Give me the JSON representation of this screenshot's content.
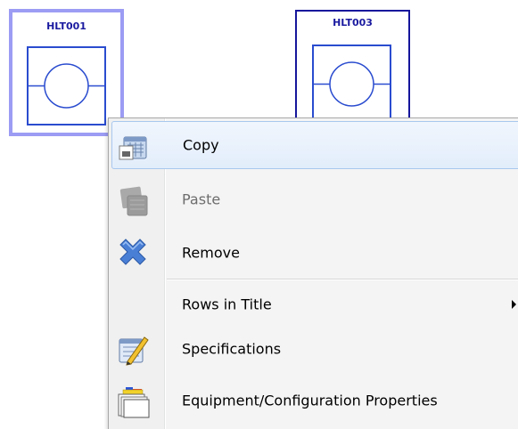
{
  "canvas": {
    "equipment": [
      {
        "title": "HLT001",
        "selected": true
      },
      {
        "title": "HLT003",
        "selected": false
      }
    ]
  },
  "context_menu": {
    "items": [
      {
        "label": "Copy",
        "icon": "copy-icon",
        "enabled": true,
        "hovered": true
      },
      {
        "label": "Paste",
        "icon": "paste-icon",
        "enabled": false
      },
      {
        "label": "Remove",
        "icon": "remove-icon",
        "enabled": true
      },
      {
        "label": "Rows in Title",
        "icon": "",
        "enabled": true,
        "has_submenu": true
      },
      {
        "label": "Specifications",
        "icon": "specifications-icon",
        "enabled": true
      },
      {
        "label": "Equipment/Configuration Properties",
        "icon": "properties-icon",
        "enabled": true
      }
    ]
  },
  "colors": {
    "selection_border": "#9c9cf4",
    "symbol_border": "#16169c",
    "symbol_line": "#2a4ccf",
    "menu_hover": "#e2edfb",
    "remove_icon": "#4a7fd6"
  }
}
